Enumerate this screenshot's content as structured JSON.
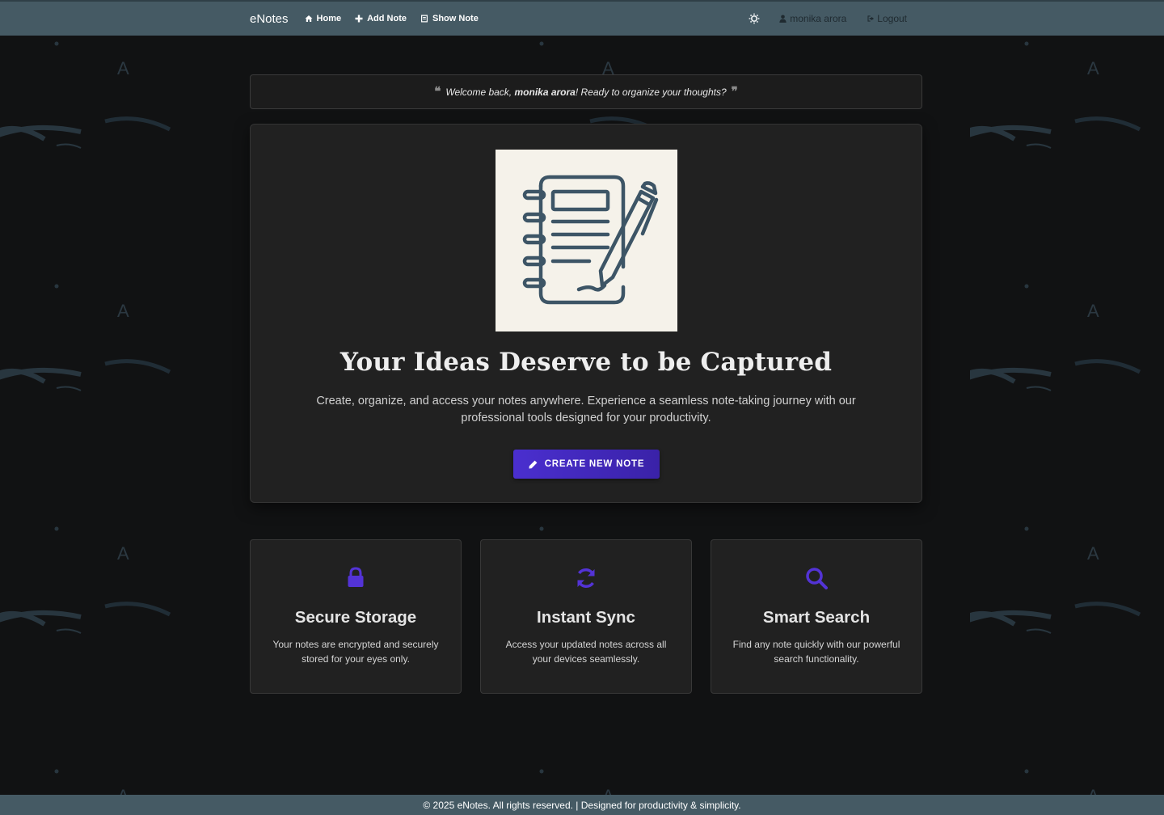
{
  "colors": {
    "navbar": "#455a64",
    "background": "#111213",
    "card": "#212121",
    "accent": "#4a2fcf",
    "icon_accent": "#5333d6"
  },
  "navbar": {
    "brand": "eNotes",
    "links": [
      {
        "label": "Home",
        "icon": "home-icon"
      },
      {
        "label": "Add Note",
        "icon": "plus-icon"
      },
      {
        "label": "Show Note",
        "icon": "document-icon"
      }
    ],
    "theme_toggle_icon": "sun-icon",
    "user": {
      "label": "monika arora",
      "icon": "user-icon"
    },
    "logout": {
      "label": "Logout",
      "icon": "sign-out-icon"
    }
  },
  "welcome": {
    "prefix": "Welcome back, ",
    "username": "monika arora",
    "suffix": "! Ready to organize your thoughts?"
  },
  "hero": {
    "image_icon": "notebook-pencil-illustration",
    "title": "Your Ideas Deserve to be Captured",
    "subtitle": "Create, organize, and access your notes anywhere. Experience a seamless note-taking journey with our professional tools designed for your productivity.",
    "cta_label": "CREATE NEW NOTE",
    "cta_icon": "pencil-icon"
  },
  "features": [
    {
      "icon": "lock-icon",
      "title": "Secure Storage",
      "description": "Your notes are encrypted and securely stored for your eyes only."
    },
    {
      "icon": "sync-icon",
      "title": "Instant Sync",
      "description": "Access your updated notes across all your devices seamlessly."
    },
    {
      "icon": "search-icon",
      "title": "Smart Search",
      "description": "Find any note quickly with our powerful search functionality."
    }
  ],
  "footer": {
    "text": "© 2025 eNotes. All rights reserved. | Designed for productivity & simplicity."
  }
}
